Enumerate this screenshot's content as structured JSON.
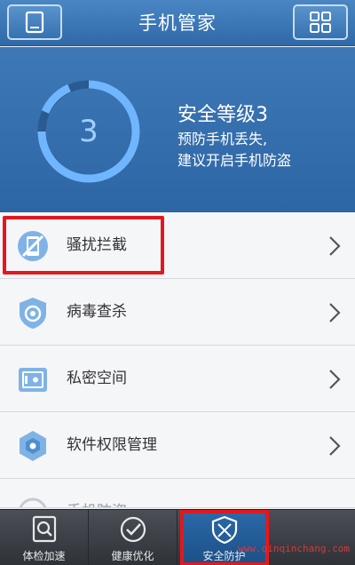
{
  "header": {
    "title": "手机管家"
  },
  "status": {
    "level_number": "3",
    "title": "安全等级3",
    "desc_line1": "预防手机丢失,",
    "desc_line2": "建议开启手机防盗"
  },
  "menu": {
    "items": [
      {
        "label": "骚扰拦截",
        "icon": "phone-block-icon"
      },
      {
        "label": "病毒查杀",
        "icon": "shield-target-icon"
      },
      {
        "label": "私密空间",
        "icon": "safe-icon"
      },
      {
        "label": "软件权限管理",
        "icon": "hexagon-icon"
      },
      {
        "label": "手机防盗",
        "icon": "locate-icon"
      }
    ]
  },
  "tabs": [
    {
      "label": "体检加速",
      "icon": "search-icon"
    },
    {
      "label": "健康优化",
      "icon": "check-icon"
    },
    {
      "label": "安全防护",
      "icon": "shield-icon",
      "active": true
    },
    {
      "label": "",
      "icon": ""
    }
  ],
  "watermark": "www.qinqinchang.com",
  "colors": {
    "header": "#3a75b4",
    "ring": "#6fb6ff",
    "highlight": "#e2181f",
    "tabbar": "#3b3f45",
    "active_tab": "#2b6aaa"
  }
}
